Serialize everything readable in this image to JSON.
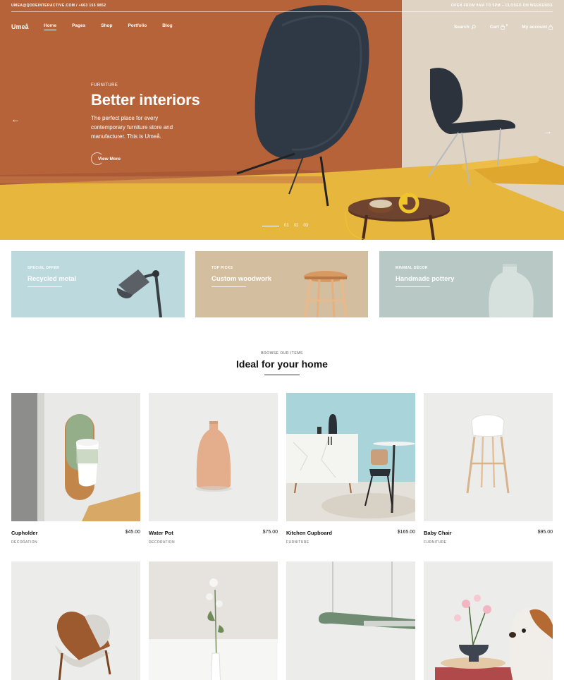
{
  "topbar": {
    "contact": "UMEA@QODEINTERACTIVE.COM / +663 155 9852",
    "hours": "OPEN FROM 9AM TO 5PM – CLOSED ON WEEKENDS"
  },
  "nav": {
    "logo": "Umeå",
    "items": [
      "Home",
      "Pages",
      "Shop",
      "Portfolio",
      "Blog"
    ],
    "search": "Search",
    "cart": "Cart",
    "cart_count": "0",
    "account": "My account"
  },
  "hero": {
    "eyebrow": "FURNITURE",
    "title": "Better interiors",
    "description": "The perfect place for every contemporary furniture store and manufacturer. This is Umeå.",
    "cta": "View More",
    "prev_arrow": "←",
    "next_arrow": "→",
    "slides": [
      "01",
      "02",
      "03"
    ]
  },
  "promos": [
    {
      "eyebrow": "SPECIAL OFFER",
      "title": "Recycled metal",
      "bg": "#bcd9de"
    },
    {
      "eyebrow": "TOP PICKS",
      "title": "Custom woodwork",
      "bg": "#d3bea0"
    },
    {
      "eyebrow": "MINIMAL DÉCOR",
      "title": "Handmade pottery",
      "bg": "#b7c8c5"
    }
  ],
  "section": {
    "eyebrow": "BROWSE OUR ITEMS",
    "title": "Ideal for your home"
  },
  "products": [
    {
      "name": "Cupholder",
      "price": "$45.00",
      "category": "DECORATION"
    },
    {
      "name": "Water Pot",
      "price": "$75.00",
      "category": "DECORATION"
    },
    {
      "name": "Kitchen Cupboard",
      "price": "$165.00",
      "category": "FURNITURE"
    },
    {
      "name": "Baby Chair",
      "price": "$95.00",
      "category": "FURNITURE"
    }
  ],
  "colors": {
    "hero_wall": "#b7633a",
    "hero_floor": "#e7b63d",
    "accent_dark": "#2b323c"
  }
}
